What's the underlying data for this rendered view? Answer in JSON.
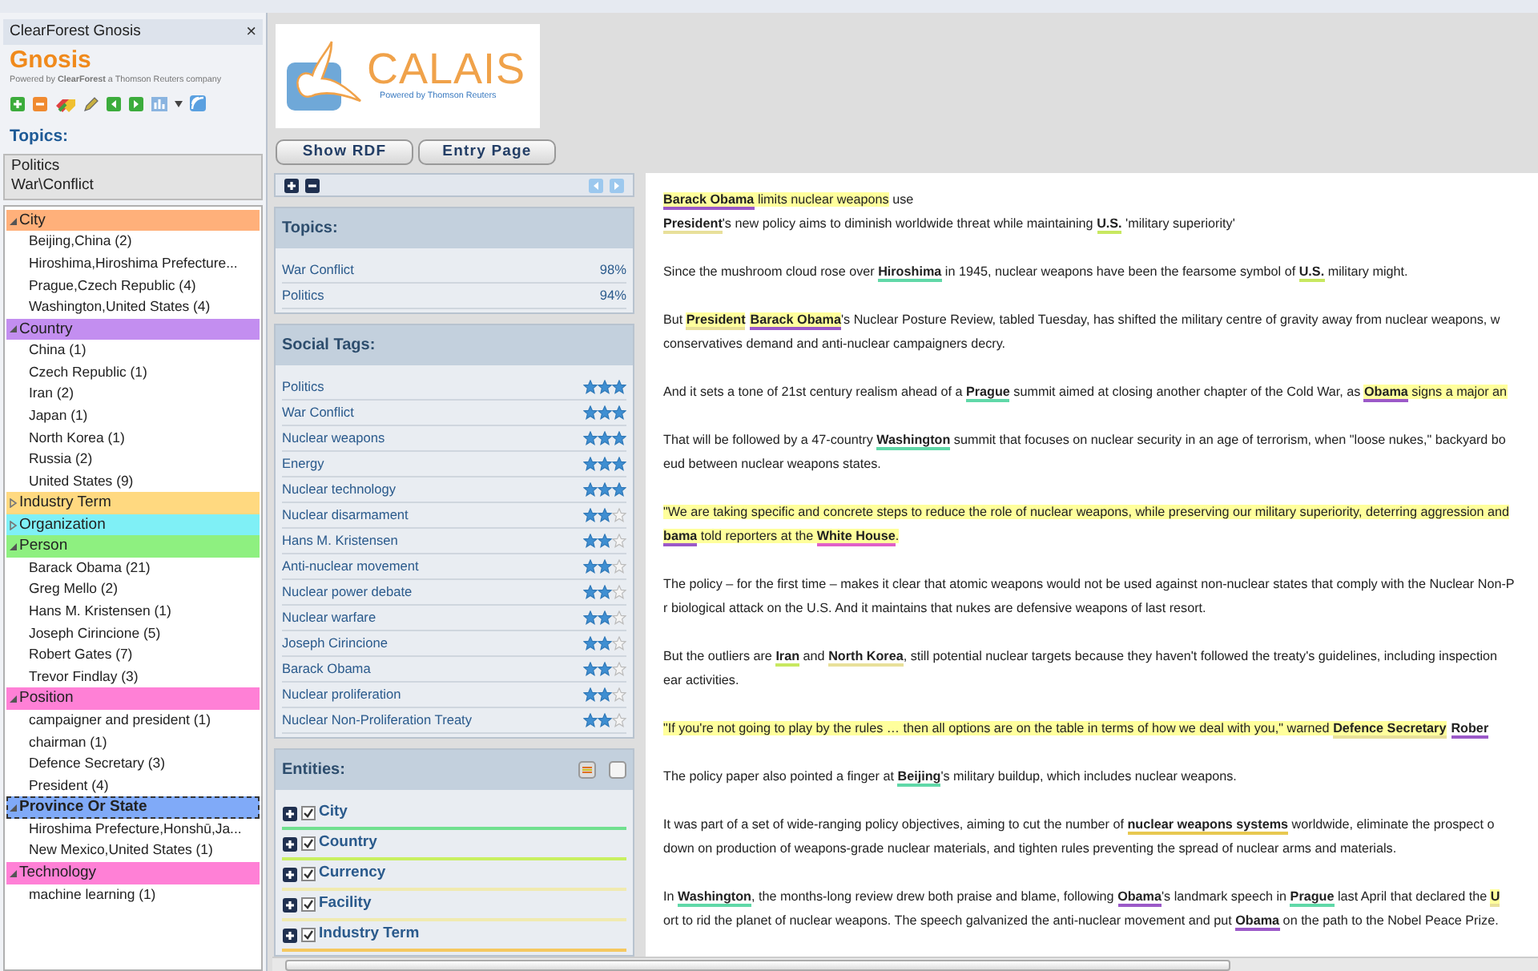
{
  "sidebar": {
    "title": "ClearForest Gnosis",
    "close": "×",
    "logo": "Gnosis",
    "tagline": "Powered by **ClearForest** a Thomson Reuters company",
    "topics_label": "Topics:",
    "topics": [
      "Politics",
      "War\\Conflict"
    ],
    "tree": [
      {
        "label": "City",
        "color": "#ffb07a",
        "expanded": true,
        "selected": false,
        "children": [
          {
            "label": "Beijing,China (2)"
          },
          {
            "label": "Hiroshima,Hiroshima Prefecture..."
          },
          {
            "label": "Prague,Czech Republic (4)"
          },
          {
            "label": "Washington,United States (4)"
          }
        ]
      },
      {
        "label": "Country",
        "color": "#c38ef0",
        "expanded": true,
        "selected": false,
        "children": [
          {
            "label": "China (1)"
          },
          {
            "label": "Czech Republic (1)"
          },
          {
            "label": "Iran (2)"
          },
          {
            "label": "Japan (1)"
          },
          {
            "label": "North Korea (1)"
          },
          {
            "label": "Russia (2)"
          },
          {
            "label": "United States (9)"
          }
        ]
      },
      {
        "label": "Industry Term",
        "color": "#ffd980",
        "expanded": false,
        "selected": false
      },
      {
        "label": "Organization",
        "color": "#7ff0f6",
        "expanded": false,
        "selected": false
      },
      {
        "label": "Person",
        "color": "#8ef080",
        "expanded": true,
        "selected": false,
        "children": [
          {
            "label": "Barack Obama (21)"
          },
          {
            "label": "Greg Mello (2)"
          },
          {
            "label": "Hans M. Kristensen (1)"
          },
          {
            "label": "Joseph Cirincione (5)"
          },
          {
            "label": "Robert Gates (7)"
          },
          {
            "label": "Trevor Findlay (3)"
          }
        ]
      },
      {
        "label": "Position",
        "color": "#ff80d6",
        "expanded": true,
        "selected": false,
        "children": [
          {
            "label": "campaigner and president (1)"
          },
          {
            "label": "chairman (1)"
          },
          {
            "label": "Defence Secretary (3)"
          },
          {
            "label": "President (4)"
          }
        ]
      },
      {
        "label": "Province Or State",
        "color": "#80aaf8",
        "expanded": true,
        "selected": true,
        "children": [
          {
            "label": "Hiroshima Prefecture,Honshū,Ja..."
          },
          {
            "label": "New Mexico,United States (1)"
          }
        ]
      },
      {
        "label": "Technology",
        "color": "#ff80d6",
        "expanded": true,
        "selected": false,
        "children": [
          {
            "label": "machine learning (1)"
          }
        ]
      }
    ]
  },
  "logo": {
    "name": "CALAIS",
    "tagline": "Powered by Thomson Reuters"
  },
  "buttons": [
    "Show RDF",
    "Entry Page"
  ],
  "topics_card": {
    "title": "Topics:",
    "rows": [
      {
        "label": "War Conflict",
        "score": "98%"
      },
      {
        "label": "Politics",
        "score": "94%"
      }
    ]
  },
  "social_tags": {
    "title": "Social Tags:",
    "rows": [
      {
        "label": "Politics",
        "stars": 3
      },
      {
        "label": "War Conflict",
        "stars": 3
      },
      {
        "label": "Nuclear weapons",
        "stars": 3
      },
      {
        "label": "Energy",
        "stars": 3
      },
      {
        "label": "Nuclear technology",
        "stars": 3
      },
      {
        "label": "Nuclear disarmament",
        "stars": 2
      },
      {
        "label": "Hans M. Kristensen",
        "stars": 2
      },
      {
        "label": "Anti-nuclear movement",
        "stars": 2
      },
      {
        "label": "Nuclear power debate",
        "stars": 2
      },
      {
        "label": "Nuclear warfare",
        "stars": 2
      },
      {
        "label": "Joseph Cirincione",
        "stars": 2
      },
      {
        "label": "Barack Obama",
        "stars": 2
      },
      {
        "label": "Nuclear proliferation",
        "stars": 2
      },
      {
        "label": "Nuclear Non-Proliferation Treaty",
        "stars": 2
      }
    ]
  },
  "entities": {
    "title": "Entities:",
    "rows": [
      {
        "label": "City",
        "checked": true,
        "color": "#70e090"
      },
      {
        "label": "Country",
        "checked": true,
        "color": "#c8f060"
      },
      {
        "label": "Currency",
        "checked": true,
        "color": "#f0eab0"
      },
      {
        "label": "Facility",
        "checked": true,
        "color": "#f0eab0"
      },
      {
        "label": "Industry Term",
        "checked": true,
        "color": "#f5c860"
      }
    ]
  },
  "article": [
    [
      [
        {
          "kind": "entity",
          "text": "Barack Obama",
          "color": "#9b59c8",
          "highlight": true
        },
        {
          "kind": "highlight",
          "text": " limits nuclear weapons"
        },
        {
          "kind": "text",
          "text": " use"
        }
      ],
      [
        {
          "kind": "entity",
          "text": "President",
          "color": "#e8e09a",
          "highlight": false
        },
        {
          "kind": "text",
          "text": "'s new policy aims to diminish worldwide threat while maintaining "
        },
        {
          "kind": "entity",
          "text": "U.S.",
          "color": "#c8e860",
          "highlight": false
        },
        {
          "kind": "text",
          "text": " 'military superiority'"
        }
      ]
    ],
    [
      [
        {
          "kind": "text",
          "text": "Since the mushroom cloud rose over "
        },
        {
          "kind": "entity",
          "text": "Hiroshima",
          "color": "#60d8a8",
          "highlight": false
        },
        {
          "kind": "text",
          "text": " in 1945, nuclear weapons have been the fearsome symbol of "
        },
        {
          "kind": "entity",
          "text": "U.S.",
          "color": "#c8e860",
          "highlight": false
        },
        {
          "kind": "text",
          "text": " military might."
        }
      ]
    ],
    [
      [
        {
          "kind": "text",
          "text": "But "
        },
        {
          "kind": "entity",
          "text": "President",
          "color": "#e8e09a",
          "highlight": true
        },
        {
          "kind": "entity",
          "text": "Barack Obama",
          "color": "#9b59c8",
          "highlight": true
        },
        {
          "kind": "text",
          "text": "'s Nuclear Posture Review, tabled Tuesday, has shifted the military centre of gravity away from nuclear weapons, w"
        }
      ],
      [
        {
          "kind": "text",
          "text": "conservatives demand and anti-nuclear campaigners decry."
        }
      ]
    ],
    [
      [
        {
          "kind": "text",
          "text": "And it sets a tone of 21st century realism ahead of a "
        },
        {
          "kind": "entity",
          "text": "Prague",
          "color": "#60d8a8",
          "highlight": false
        },
        {
          "kind": "text",
          "text": " summit aimed at closing another chapter of the Cold War, as "
        },
        {
          "kind": "entity",
          "text": "Obama",
          "color": "#9b59c8",
          "highlight": true
        },
        {
          "kind": "highlight",
          "text": " signs a major an"
        }
      ]
    ],
    [
      [
        {
          "kind": "text",
          "text": "That will be followed by a 47-country "
        },
        {
          "kind": "entity",
          "text": "Washington",
          "color": "#60d8a8",
          "highlight": false
        },
        {
          "kind": "text",
          "text": " summit that focuses on nuclear security in an age of terrorism, when \"loose nukes,\" backyard bo"
        }
      ],
      [
        {
          "kind": "text",
          "text": "eud between nuclear weapons states."
        }
      ]
    ],
    [
      [
        {
          "kind": "highlight",
          "text": "\"We are taking specific and concrete steps to reduce the role of nuclear weapons, while preserving our military superiority, deterring aggression and"
        }
      ],
      [
        {
          "kind": "entity",
          "text": "bama",
          "color": "#9b59c8",
          "highlight": true
        },
        {
          "kind": "highlight",
          "text": " told reporters at the "
        },
        {
          "kind": "entity",
          "text": "White House",
          "color": "#e060c8",
          "highlight": true
        },
        {
          "kind": "highlight",
          "text": "."
        }
      ]
    ],
    [
      [
        {
          "kind": "text",
          "text": "The policy – for the first time – makes it clear that atomic weapons would not be used against non-nuclear states that comply with the Nuclear Non-P"
        }
      ],
      [
        {
          "kind": "text",
          "text": "r biological attack on the U.S. And it maintains that nukes are defensive weapons of last resort."
        }
      ]
    ],
    [
      [
        {
          "kind": "text",
          "text": "But the outliers are "
        },
        {
          "kind": "entity",
          "text": "Iran",
          "color": "#c8e860",
          "highlight": false
        },
        {
          "kind": "text",
          "text": " and "
        },
        {
          "kind": "entity",
          "text": "North Korea",
          "color": "#e8e09a",
          "highlight": false
        },
        {
          "kind": "text",
          "text": ", still potential nuclear targets because they haven't followed the treaty's guidelines, including inspection"
        }
      ],
      [
        {
          "kind": "text",
          "text": "ear activities."
        }
      ]
    ],
    [
      [
        {
          "kind": "highlight",
          "text": "\"If you're not going to play by the rules … then all options are on the table in terms of how we deal with you,\" warned "
        },
        {
          "kind": "entity",
          "text": "Defence Secretary",
          "color": "#e8e09a",
          "highlight": true
        },
        {
          "kind": "entity",
          "text": "Rober",
          "color": "#9b59c8",
          "highlight": false
        }
      ]
    ],
    [
      [
        {
          "kind": "text",
          "text": "The policy paper also pointed a finger at "
        },
        {
          "kind": "entity",
          "text": "Beijing",
          "color": "#60d8a8",
          "highlight": false
        },
        {
          "kind": "text",
          "text": "'s military buildup, which includes nuclear weapons."
        }
      ]
    ],
    [
      [
        {
          "kind": "text",
          "text": "It was part of a set of wide-ranging policy objectives, aiming to cut the number of "
        },
        {
          "kind": "entity",
          "text": "nuclear weapons systems",
          "color": "#e8c850",
          "highlight": false
        },
        {
          "kind": "text",
          "text": " worldwide, eliminate the prospect o"
        }
      ],
      [
        {
          "kind": "text",
          "text": "down on production of weapons-grade nuclear materials, and tighten rules preventing the spread of nuclear arms and materials."
        }
      ]
    ],
    [
      [
        {
          "kind": "text",
          "text": "In "
        },
        {
          "kind": "entity",
          "text": "Washington",
          "color": "#60d8a8",
          "highlight": false
        },
        {
          "kind": "text",
          "text": ", the months-long review drew both praise and blame, following "
        },
        {
          "kind": "entity",
          "text": "Obama",
          "color": "#9b59c8",
          "highlight": false
        },
        {
          "kind": "text",
          "text": "'s landmark speech in "
        },
        {
          "kind": "entity",
          "text": "Prague",
          "color": "#60d8a8",
          "highlight": false
        },
        {
          "kind": "text",
          "text": " last April that declared the "
        },
        {
          "kind": "entity",
          "text": "U",
          "color": "#e8e09a",
          "highlight": true
        }
      ],
      [
        {
          "kind": "text",
          "text": "ort to rid the planet of nuclear weapons. The speech galvanized the anti-nuclear movement and put "
        },
        {
          "kind": "entity",
          "text": "Obama",
          "color": "#9b59c8",
          "highlight": false
        },
        {
          "kind": "text",
          "text": " on the path to the Nobel Peace Prize."
        }
      ]
    ]
  ]
}
